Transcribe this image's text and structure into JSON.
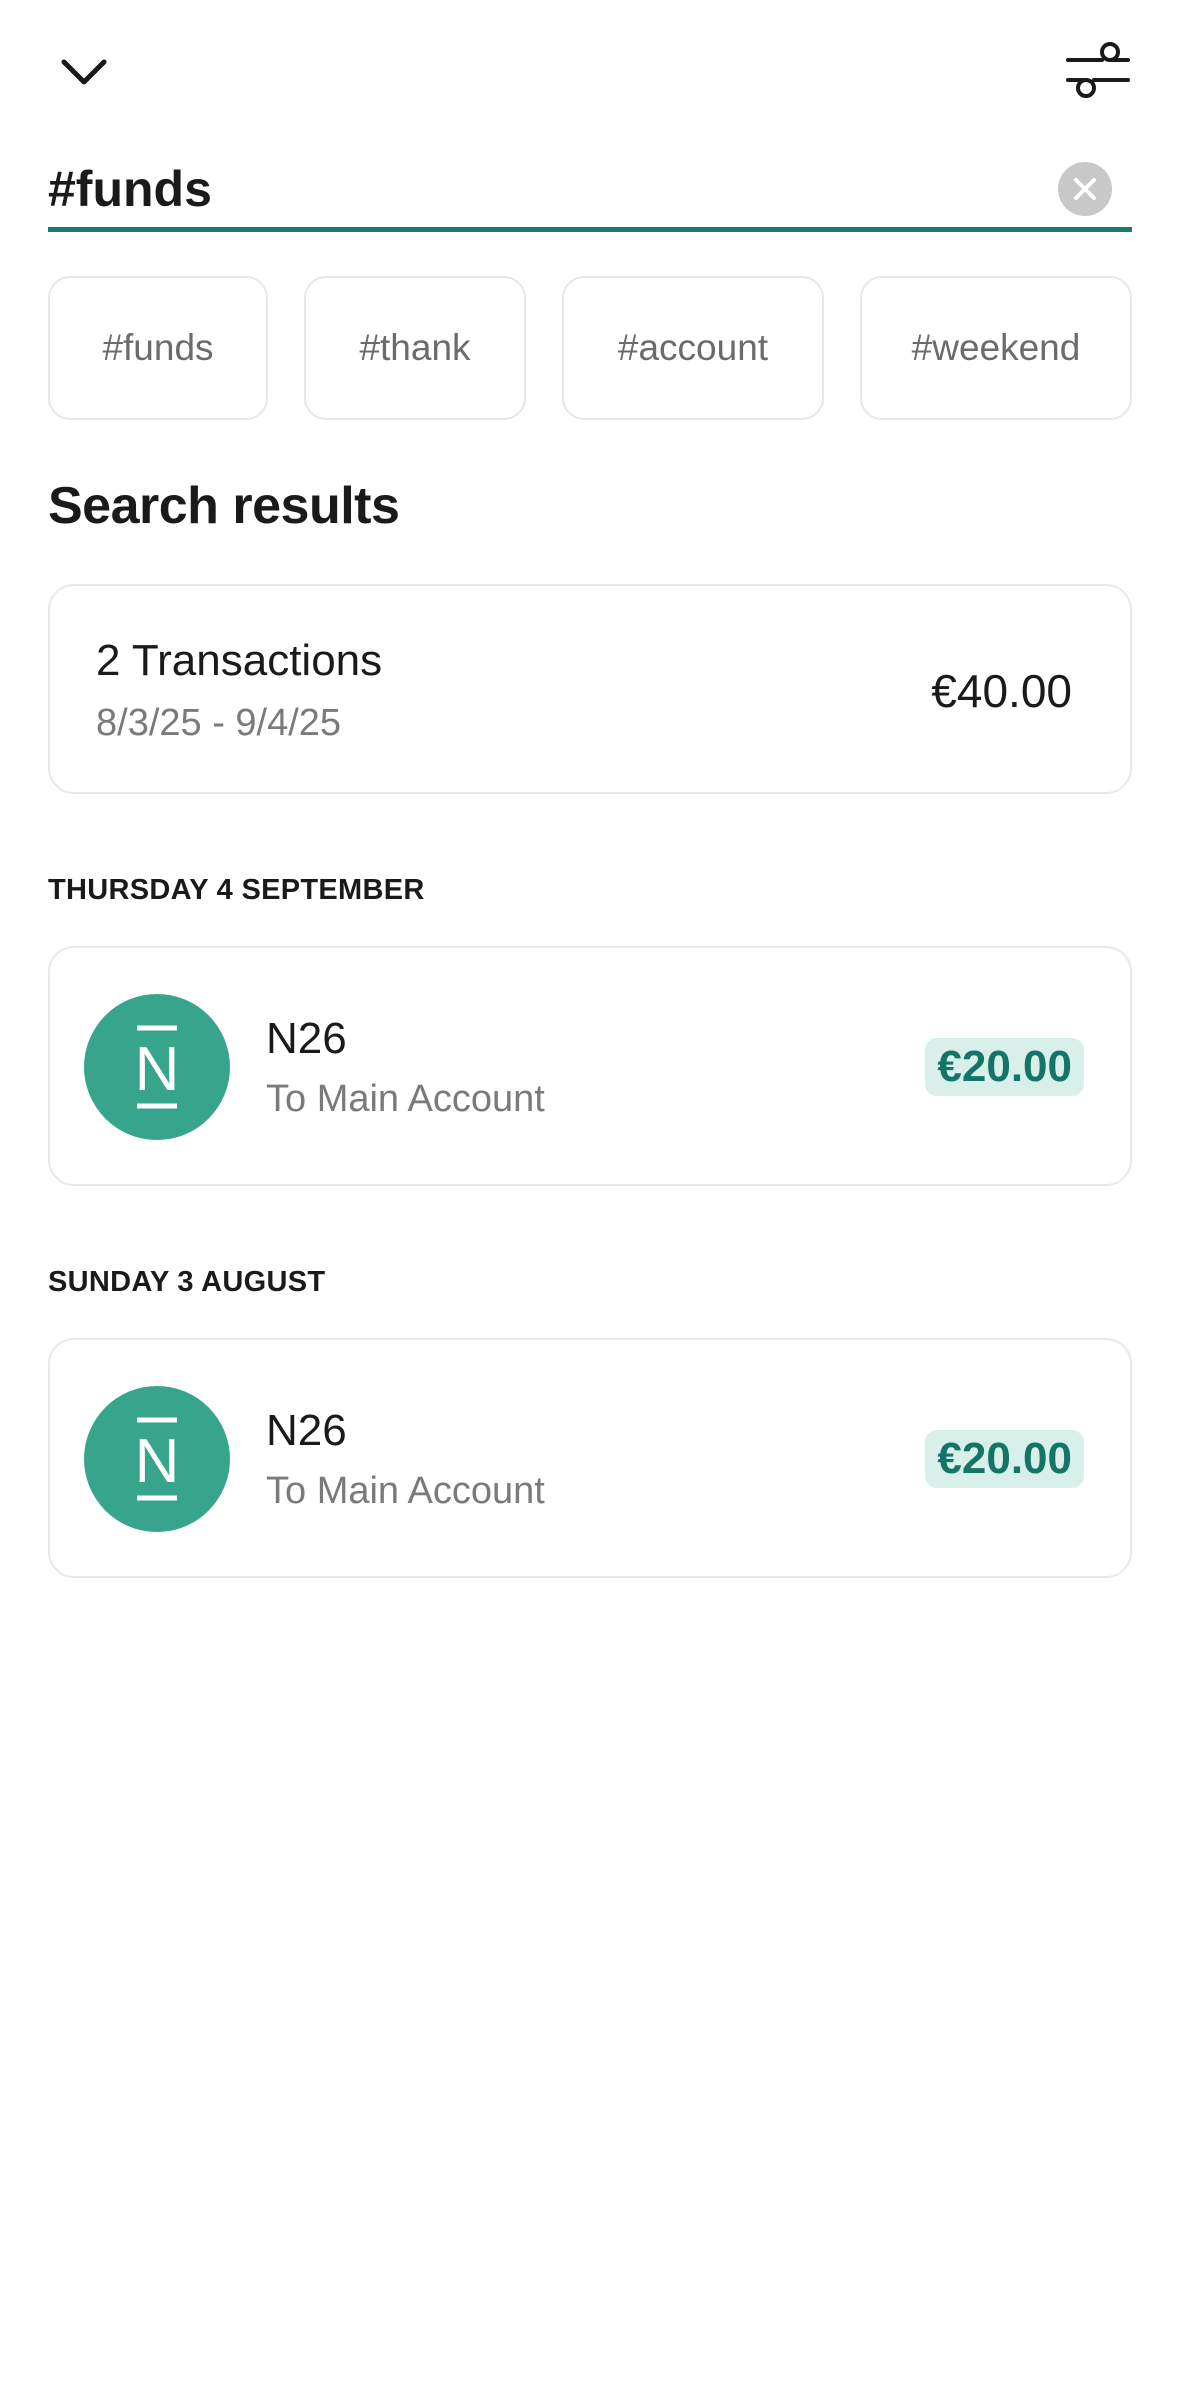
{
  "header": {
    "back_icon": "chevron-down-icon",
    "filter_icon": "sliders-icon"
  },
  "search": {
    "value": "#funds",
    "clear_icon": "close-circle-icon",
    "accent_color": "#1a7a6c"
  },
  "suggestions": [
    "#funds",
    "#thank",
    "#account",
    "#weekend"
  ],
  "results": {
    "title": "Search results",
    "summary": {
      "count_label": "2 Transactions",
      "date_range": "8/3/25 - 9/4/25",
      "total": "€40.00"
    },
    "groups": [
      {
        "date": "THURSDAY 4 SEPTEMBER",
        "transaction": {
          "logo": "n26-logo",
          "logo_letter": "N",
          "name": "N26",
          "description": "To Main Account",
          "amount": "€20.00"
        }
      },
      {
        "date": "SUNDAY 3 AUGUST",
        "transaction": {
          "logo": "n26-logo",
          "logo_letter": "N",
          "name": "N26",
          "description": "To Main Account",
          "amount": "€20.00"
        }
      }
    ]
  },
  "colors": {
    "brand_green": "#36a58b",
    "amount_text": "#137565",
    "amount_bg": "#d9efea"
  }
}
